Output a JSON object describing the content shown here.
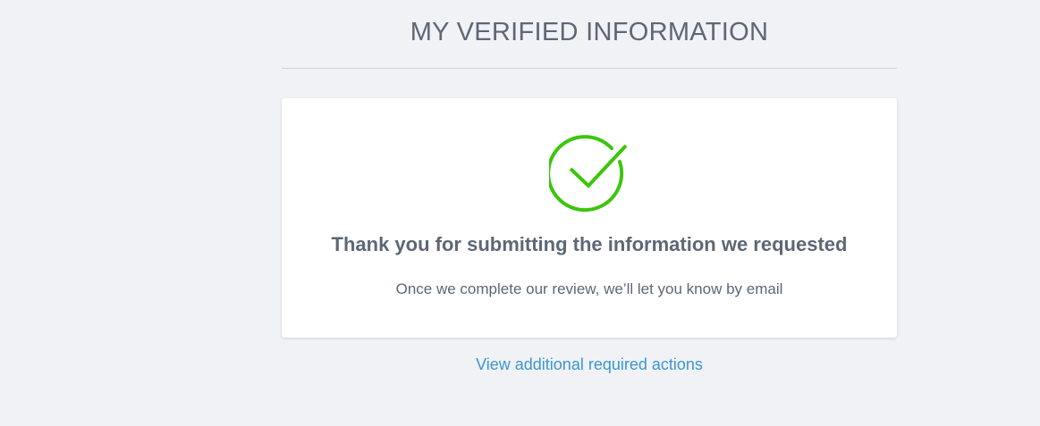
{
  "page": {
    "title": "MY VERIFIED INFORMATION"
  },
  "confirmation": {
    "icon": "checkmark-circle-icon",
    "icon_color": "#3cc60c",
    "heading": "Thank you for submitting the information we requested",
    "message": "Once we complete our review, we’ll let you know by email"
  },
  "links": {
    "additional_actions": "View additional required actions"
  },
  "colors": {
    "background": "#f1f2f6",
    "text": "#5d6775",
    "link": "#3a97d1"
  }
}
